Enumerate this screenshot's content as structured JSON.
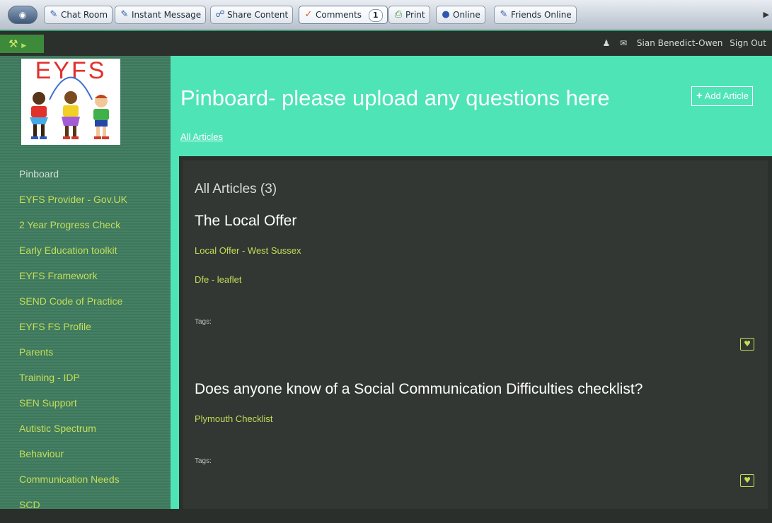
{
  "toolbar": {
    "buttons": [
      {
        "label": "Chat Room",
        "icon": "chat-icon"
      },
      {
        "label": "Instant Message",
        "icon": "im-icon"
      },
      {
        "label": "Share Content",
        "icon": "share-icon"
      },
      {
        "label": "Comments",
        "icon": "comments-icon",
        "badge": "1"
      },
      {
        "label": "Print",
        "icon": "print-icon"
      },
      {
        "label": "Online",
        "icon": "globe-icon"
      },
      {
        "label": "Friends Online",
        "icon": "friends-icon"
      }
    ]
  },
  "topbar": {
    "user_name": "Sian Benedict-Owen",
    "sign_out": "Sign Out"
  },
  "logo": {
    "text": "EYFS"
  },
  "sidebar": {
    "items": [
      "Pinboard",
      "EYFS Provider - Gov.UK",
      "2 Year Progress Check",
      "Early Education toolkit",
      "EYFS Framework",
      "SEND Code of Practice",
      "EYFS FS Profile",
      "Parents",
      "Training - IDP",
      "SEN Support",
      "Autistic Spectrum",
      "Behaviour",
      "Communication Needs",
      "SCD"
    ]
  },
  "header": {
    "title": "Pinboard- please upload any questions here",
    "add_article": "Add Article",
    "breadcrumb": "All Articles"
  },
  "main": {
    "list_title": "All Articles (3)",
    "articles": [
      {
        "title": "The Local Offer",
        "links": [
          "Local Offer - West Sussex",
          "Dfe - leaflet"
        ],
        "tags_label": "Tags:"
      },
      {
        "title": "Does anyone know of a Social Communication Difficulties checklist?",
        "links": [
          "Plymouth Checklist"
        ],
        "tags_label": "Tags:"
      }
    ]
  },
  "colors": {
    "accent": "#4fe4b6",
    "sidebar": "#3f7b5f",
    "link": "#c4de58",
    "content_bg": "#323733"
  }
}
